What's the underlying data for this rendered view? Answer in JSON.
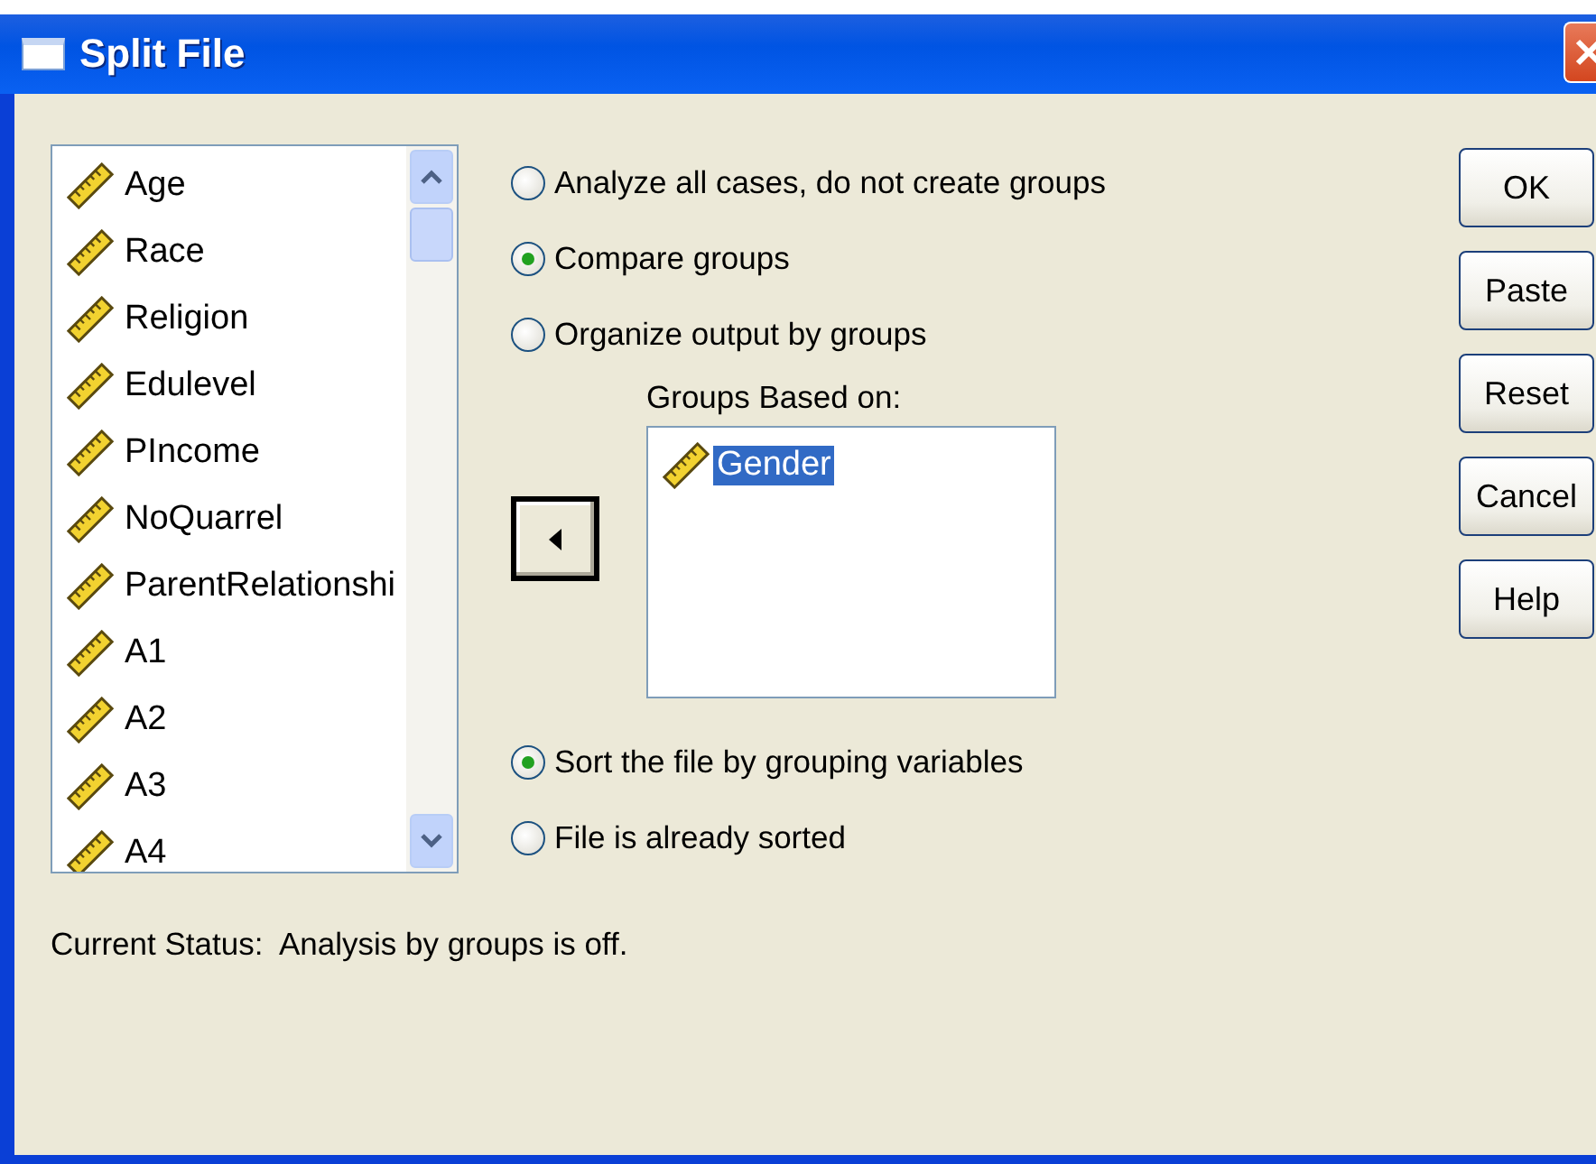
{
  "window": {
    "title": "Split File"
  },
  "variables": [
    {
      "name": "Age",
      "selected": false
    },
    {
      "name": "Race",
      "selected": false
    },
    {
      "name": "Religion",
      "selected": false
    },
    {
      "name": "Edulevel",
      "selected": false
    },
    {
      "name": "PIncome",
      "selected": false
    },
    {
      "name": "NoQuarrel",
      "selected": false
    },
    {
      "name": "ParentRelationshi",
      "selected": false
    },
    {
      "name": "A1",
      "selected": false
    },
    {
      "name": "A2",
      "selected": false
    },
    {
      "name": "A3",
      "selected": false
    },
    {
      "name": "A4",
      "selected": false
    }
  ],
  "mode_options": [
    {
      "label": "Analyze all cases, do not create groups",
      "selected": false
    },
    {
      "label": "Compare groups",
      "selected": true
    },
    {
      "label": "Organize output by groups",
      "selected": false
    }
  ],
  "groups_based_on": {
    "label": "Groups Based on:",
    "items": [
      {
        "name": "Gender",
        "selected": true
      }
    ]
  },
  "sort_options": [
    {
      "label": "Sort the file by grouping variables",
      "selected": true
    },
    {
      "label": "File is already sorted",
      "selected": false
    }
  ],
  "status": "Current Status:  Analysis by groups is off.",
  "buttons": [
    "OK",
    "Paste",
    "Reset",
    "Cancel",
    "Help"
  ]
}
